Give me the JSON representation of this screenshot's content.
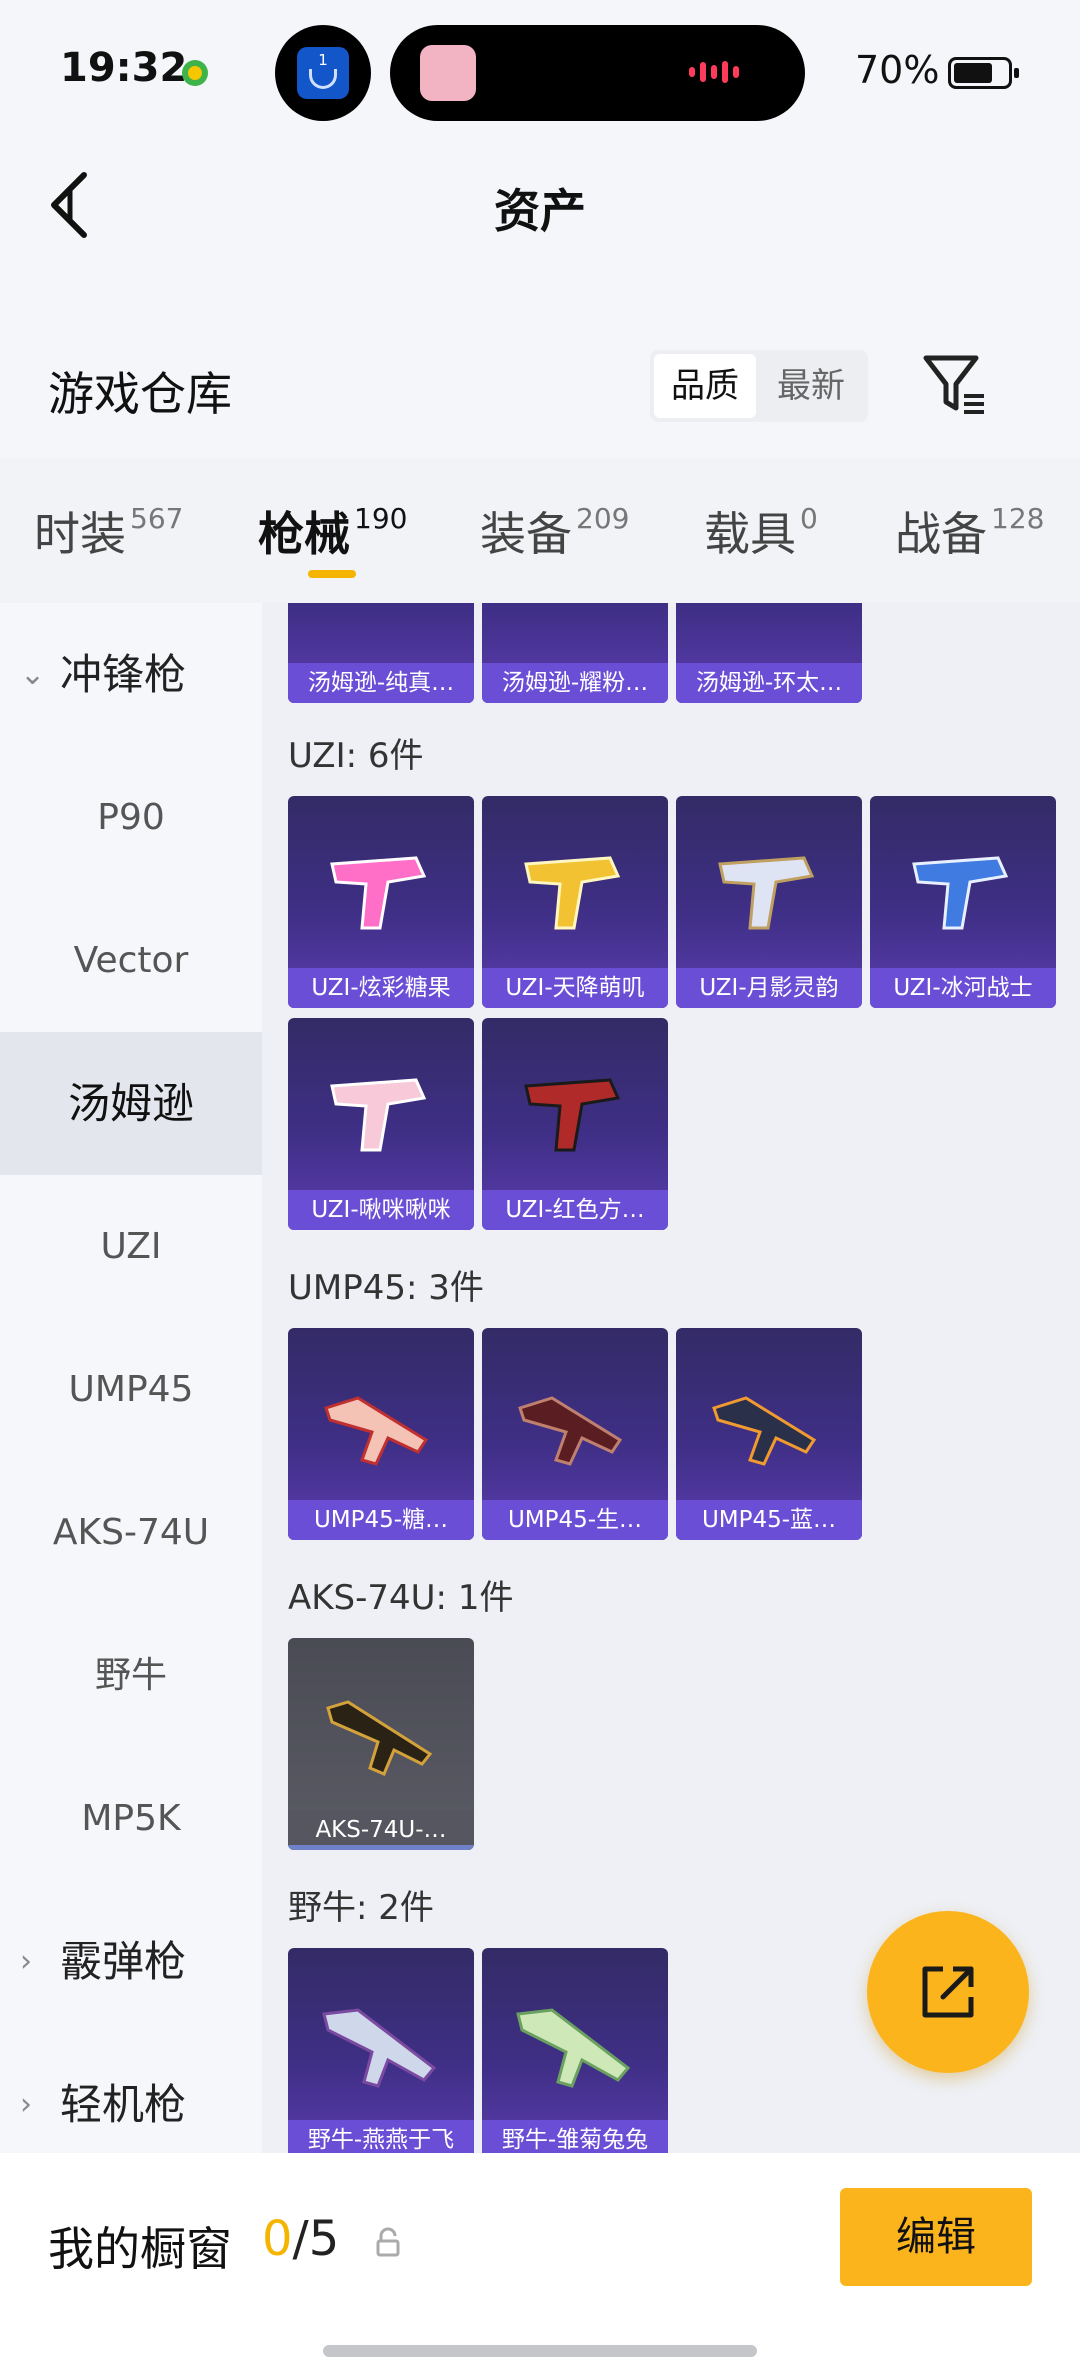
{
  "status_bar": {
    "time": "19:32",
    "battery": "70%",
    "island_badge": "1"
  },
  "header": {
    "title": "资产"
  },
  "warehouse": {
    "title": "游戏仓库",
    "sort_options": [
      "品质",
      "最新"
    ],
    "selected_sort": "品质"
  },
  "tabs": [
    {
      "label": "时装",
      "count": "567",
      "active": false
    },
    {
      "label": "枪械",
      "count": "190",
      "active": true
    },
    {
      "label": "装备",
      "count": "209",
      "active": false
    },
    {
      "label": "载具",
      "count": "0",
      "active": false
    },
    {
      "label": "战备",
      "count": "128",
      "active": false
    }
  ],
  "sidebar": {
    "items": [
      {
        "label": "冲锋枪",
        "type": "group",
        "expanded": true
      },
      {
        "label": "P90"
      },
      {
        "label": "Vector"
      },
      {
        "label": "汤姆逊",
        "selected": true
      },
      {
        "label": "UZI"
      },
      {
        "label": "UMP45"
      },
      {
        "label": "AKS-74U"
      },
      {
        "label": "野牛"
      },
      {
        "label": "MP5K"
      },
      {
        "label": "霰弹枪",
        "type": "group",
        "expanded": false
      },
      {
        "label": "轻机枪",
        "type": "group",
        "expanded": false
      }
    ]
  },
  "content": {
    "partial_cards": [
      "汤姆逊-纯真…",
      "汤姆逊-耀粉…",
      "汤姆逊-环太…"
    ],
    "sections": [
      {
        "title": "UZI: 6件",
        "items": [
          "UZI-炫彩糖果",
          "UZI-天降萌叽",
          "UZI-月影灵韵",
          "UZI-冰河战士",
          "UZI-啾咪啾咪",
          "UZI-红色方…"
        ]
      },
      {
        "title": "UMP45: 3件",
        "items": [
          "UMP45-糖…",
          "UMP45-生…",
          "UMP45-蓝…"
        ]
      },
      {
        "title": "AKS-74U: 1件",
        "items": [
          "AKS-74U-…"
        ]
      },
      {
        "title": "野牛: 2件",
        "items": [
          "野牛-燕燕于飞",
          "野牛-雏菊兔兔"
        ]
      }
    ]
  },
  "bottom_bar": {
    "label": "我的橱窗",
    "current": "0",
    "total": "/5",
    "edit_label": "编辑"
  },
  "colors": {
    "accent": "#fbb41c",
    "card_label": "#6a4fd6",
    "card_bg": "#3f2f86"
  }
}
